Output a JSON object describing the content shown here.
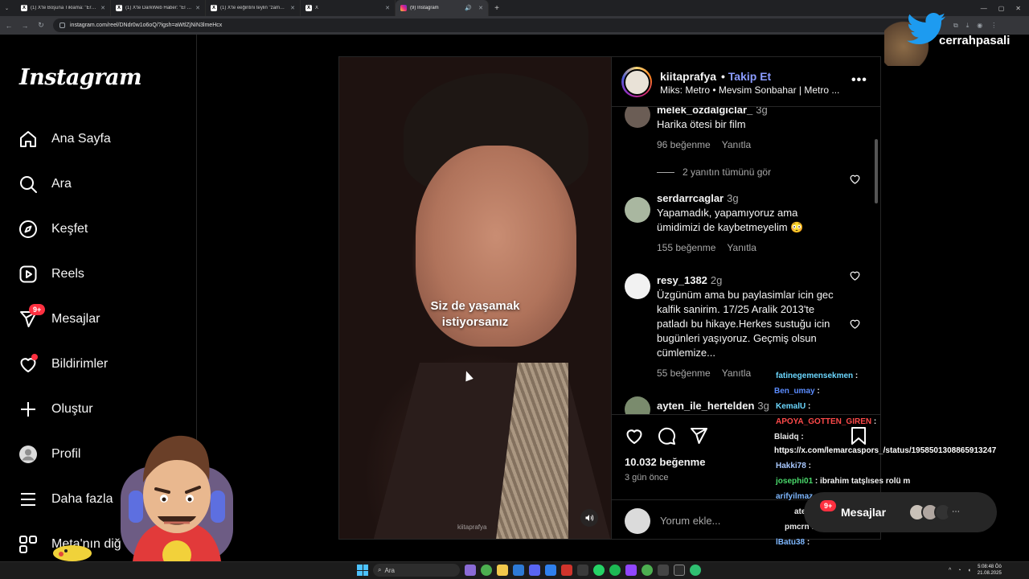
{
  "browser": {
    "tabs": [
      {
        "title": "(1) X'te Boşuna Tıklama: \"Erol ...",
        "favicon": "X"
      },
      {
        "title": "(1) X'te DarkWeb Haber: \"El Sa...",
        "favicon": "X"
      },
      {
        "title": "(1) X'te eeğintini teylin \"zamane...",
        "favicon": "X"
      },
      {
        "title": "X",
        "favicon": "X"
      },
      {
        "title": "(9) Instagram",
        "favicon": "ig",
        "active": true
      }
    ],
    "url": "instagram.com/reel/DNdr0w1o6oQ/?igsh=aWtlZjNiN3lmeHcx"
  },
  "sidebar": {
    "logo": "Instagram",
    "items": [
      {
        "label": "Ana Sayfa",
        "icon": "home-icon"
      },
      {
        "label": "Ara",
        "icon": "search-icon"
      },
      {
        "label": "Keşfet",
        "icon": "compass-icon"
      },
      {
        "label": "Reels",
        "icon": "reels-icon"
      },
      {
        "label": "Mesajlar",
        "icon": "messenger-icon",
        "badge": "9+"
      },
      {
        "label": "Bildirimler",
        "icon": "heart-icon",
        "dot": true
      },
      {
        "label": "Oluştur",
        "icon": "plus-icon"
      },
      {
        "label": "Profil",
        "icon": "profile-icon"
      },
      {
        "label": "Daha fazla",
        "icon": "menu-icon"
      },
      {
        "label": "Meta'nın diğ",
        "icon": "meta-apps-icon"
      }
    ]
  },
  "reel": {
    "caption_line1": "Siz de yaşamak",
    "caption_line2": "istiyorsanız",
    "watermark": "kiitaprafya"
  },
  "post": {
    "username": "kiitaprafya",
    "follow_label": "Takip Et",
    "dot": "•",
    "subtitle": "Miks: Metro • Mevsim Sonbahar | Metro ...",
    "comments": [
      {
        "user": "melek_ozdalgiclar_",
        "time": "3g",
        "text": "Harika ötesi bir film",
        "likes": "96 beğenme",
        "reply": "Yanıtla"
      },
      {
        "user": "serdarrcaglar",
        "time": "3g",
        "text": "Yapamadık, yapamıyoruz ama ümidimizi de kaybetmeyelim 😳",
        "likes": "155 beğenme",
        "reply": "Yanıtla"
      },
      {
        "user": "resy_1382",
        "time": "2g",
        "text": "Üzgünüm ama bu paylasimlar icin gec kalfik sanirim. 17/25 Aralik 2013'te patladı bu hikaye.Herkes sustuğu icin bugünleri yaşıyoruz. Geçmiş olsun cümlemize...",
        "likes": "55 beğenme",
        "reply": "Yanıtla"
      },
      {
        "user": "ayten_ile_hertelden",
        "time": "3g"
      }
    ],
    "view_replies": "2 yanıtın tümünü gör",
    "like_count": "10.032 beğenme",
    "time_ago": "3 gün önce",
    "comment_placeholder": "Yorum ekle..."
  },
  "overlay": {
    "twitter_handle": "cerrahpasali",
    "chat": [
      {
        "user": "fatinegemensekmen",
        "msg": " :",
        "color": "#6bd7ff"
      },
      {
        "user": "Ben_umay",
        "msg": " :",
        "color": "#5b8cff"
      },
      {
        "user": "KemalU",
        "msg": " :",
        "color": "#6bd7ff"
      },
      {
        "user": "APOYA_GOTTEN_GIREN",
        "msg": " :",
        "color": "#ff4a4a"
      },
      {
        "user": "Blaidq",
        "msg": " :",
        "color": "#e8e8e8"
      },
      {
        "user": "https://x.com/lemarcaspors_/status/1958501308865913247",
        "msg": "",
        "color": "#ffffff"
      },
      {
        "user": "Hakki78",
        "msg": " :",
        "color": "#a8c8ff"
      },
      {
        "user": "josephi01",
        "msg": " : ibrahim tatşlıses rolü m",
        "color": "#4ad96b"
      },
      {
        "user": "arifyilmaz",
        "msg": " :",
        "color": "#7fb8ff"
      },
      {
        "user": "atesparem",
        "msg": " :",
        "color": "#e8e8e8"
      },
      {
        "user": "pmcrn",
        "msg": " :",
        "color": "#e8e8e8"
      },
      {
        "user": "lBatu38",
        "msg": " :",
        "color": "#7fb8ff"
      }
    ]
  },
  "floating_messages": {
    "label": "Mesajlar",
    "badge": "9+"
  },
  "taskbar": {
    "search": "Ara",
    "time": "5:08:48 Öö",
    "date": "21.08.2025"
  },
  "colors": {
    "accent_blue": "#8b9cff",
    "badge_red": "#ff3040",
    "border": "#262626"
  }
}
